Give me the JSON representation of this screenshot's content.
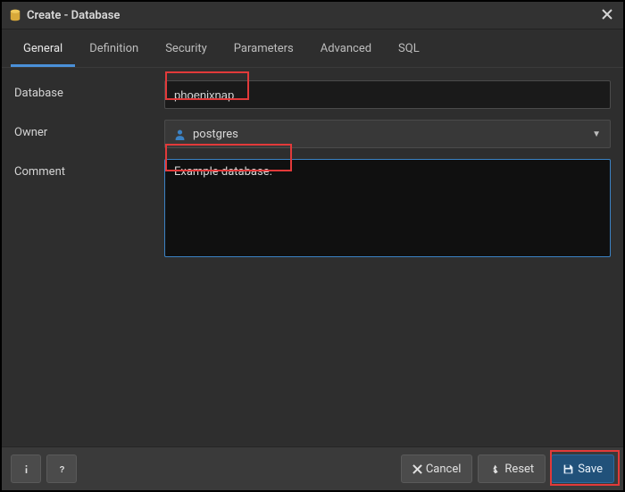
{
  "window": {
    "title": "Create - Database"
  },
  "tabs": {
    "general": "General",
    "definition": "Definition",
    "security": "Security",
    "parameters": "Parameters",
    "advanced": "Advanced",
    "sql": "SQL"
  },
  "form": {
    "database_label": "Database",
    "database_value": "phoenixnap",
    "owner_label": "Owner",
    "owner_value": "postgres",
    "comment_label": "Comment",
    "comment_value": "Example database."
  },
  "footer": {
    "info_tooltip": "i",
    "help_tooltip": "?",
    "cancel": "Cancel",
    "reset": "Reset",
    "save": "Save"
  },
  "icons": {
    "database": "database-icon",
    "close": "close-icon",
    "user": "user-icon",
    "chevron_down": "chevron-down-icon",
    "info": "info-icon",
    "help": "help-icon",
    "cancel": "cancel-icon",
    "reset": "reset-icon",
    "save": "save-icon"
  }
}
